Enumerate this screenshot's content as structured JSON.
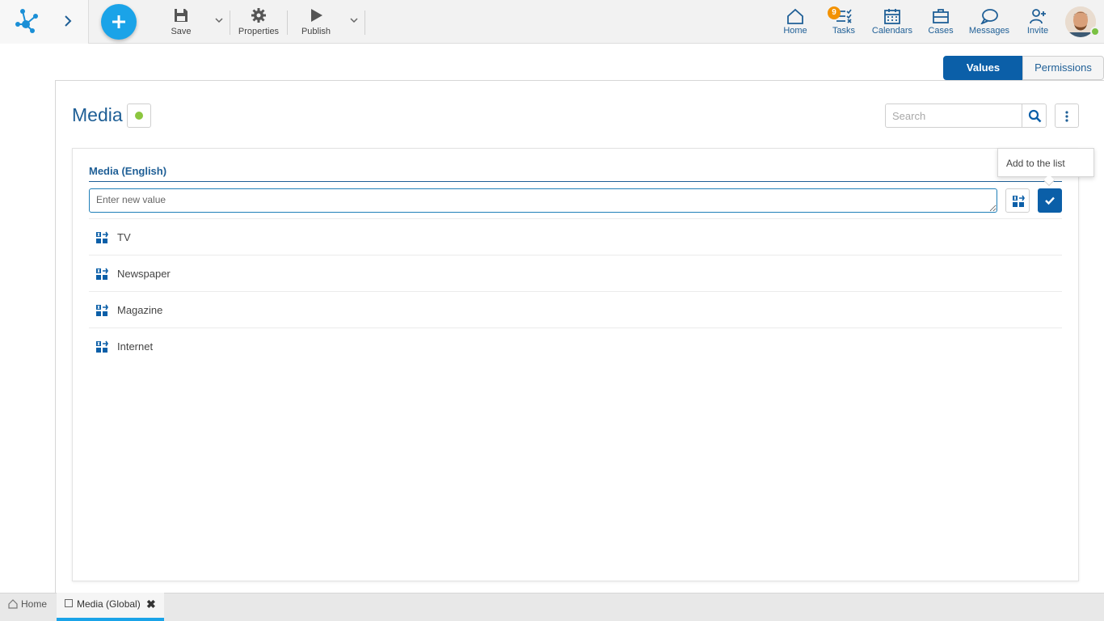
{
  "toolbar": {
    "save_label": "Save",
    "properties_label": "Properties",
    "publish_label": "Publish"
  },
  "nav": {
    "home": "Home",
    "tasks": "Tasks",
    "tasks_badge": "9",
    "calendars": "Calendars",
    "cases": "Cases",
    "messages": "Messages",
    "invite": "Invite"
  },
  "view_toggle": {
    "values": "Values",
    "permissions": "Permissions",
    "selected": "Values"
  },
  "page": {
    "title": "Media",
    "status_color": "#8cc63f",
    "search_placeholder": "Search"
  },
  "list": {
    "section_title": "Media (English)",
    "new_value_placeholder": "Enter new value",
    "tooltip": "Add to the list",
    "items": [
      {
        "label": "TV"
      },
      {
        "label": "Newspaper"
      },
      {
        "label": "Magazine"
      },
      {
        "label": "Internet"
      }
    ]
  },
  "bottom_tabs": {
    "home": "Home",
    "active": "Media (Global)"
  },
  "colors": {
    "accent": "#0b5fa8",
    "fab": "#1aa3e8",
    "badge": "#f39200"
  }
}
